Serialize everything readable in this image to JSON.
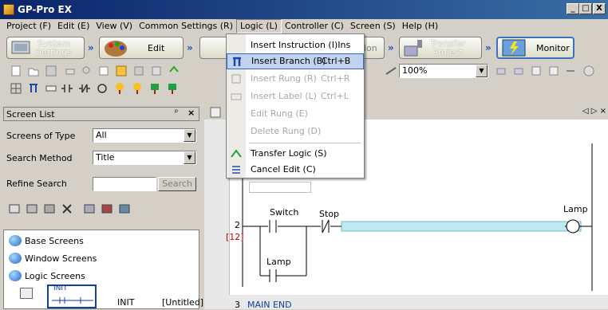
{
  "window": {
    "title": "GP-Pro EX",
    "min": "_",
    "max": "□",
    "close": "X"
  },
  "menubar": [
    "Project (F)",
    "Edit (E)",
    "View (V)",
    "Common Settings (R)",
    "Logic (L)",
    "Controller (C)",
    "Screen (S)",
    "Help (H)"
  ],
  "workflow": {
    "system_settings": "System\nSettings",
    "edit": "Edit",
    "edit_partial": "ion",
    "transfer_project": "Transfer\nProject",
    "monitor": "Monitor"
  },
  "toolbar": {
    "zoom": "100%"
  },
  "logic_menu": {
    "items": [
      {
        "label": "Insert Instruction (I)Ins",
        "shortcut": "",
        "enabled": true
      },
      {
        "label": "Insert Branch (B)",
        "shortcut": "Ctrl+B",
        "enabled": true,
        "highlighted": true
      },
      {
        "label": "Insert Rung (R)",
        "shortcut": "Ctrl+R",
        "enabled": false
      },
      {
        "label": "Insert Label (L)",
        "shortcut": "Ctrl+L",
        "enabled": false
      },
      {
        "label": "Edit Rung (E)",
        "shortcut": "",
        "enabled": false
      },
      {
        "label": "Delete Rung (D)",
        "shortcut": "",
        "enabled": false
      },
      {
        "label": "Transfer Logic (S)",
        "shortcut": "",
        "enabled": true
      },
      {
        "label": "Cancel Edit (C)",
        "shortcut": "",
        "enabled": true
      }
    ]
  },
  "screen_list": {
    "title": "Screen List",
    "pin": "ᵖ",
    "close": "×",
    "screens_of_type_label": "Screens of Type",
    "screens_of_type_value": "All",
    "search_method_label": "Search Method",
    "search_method_value": "Title",
    "refine_search_label": "Refine Search",
    "refine_search_value": "",
    "search_button": "Search",
    "items": [
      "Base Screens",
      "Window Screens",
      "Logic Screens"
    ],
    "thumb_label": "INIT",
    "thumb_name": "INIT",
    "thumb_title": "[Untitled]"
  },
  "editor": {
    "nav": "◁ ▷ ×",
    "rung_number": "2",
    "rung_step": "[12]",
    "switch_label": "Switch",
    "stop_label": "Stop",
    "lamp_label": "Lamp",
    "lamp_branch_label": "Lamp",
    "next_rung": "3",
    "main_end": "MAIN END"
  },
  "colors": {
    "titlebar": "#0a246a",
    "highlight": "#c1d2ee",
    "rung_select": "#bfe8f0",
    "accent": "#316ac5"
  }
}
